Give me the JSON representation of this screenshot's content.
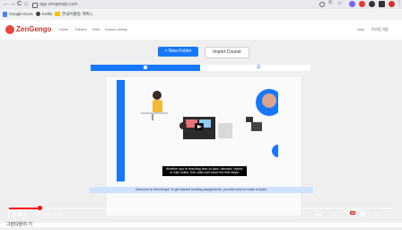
{
  "browser": {
    "nav": {
      "back": "←",
      "forward": "→",
      "reload": "C",
      "home": "⌂"
    },
    "url": "app.zengengo.com",
    "bookmarks": [
      {
        "label": "Google Docs",
        "icon": "docs-icon"
      },
      {
        "label": "Kellio",
        "icon": "kellio-icon"
      },
      {
        "label": "한국어활동 계획 L",
        "icon": "folder-icon"
      }
    ],
    "extension_colors": [
      "#7b61ff",
      "#e53935",
      "#333333",
      "#333333",
      "#d93025"
    ]
  },
  "app": {
    "brand": "ZenGengo",
    "nav": [
      "Home",
      "Folders",
      "Files",
      "Lesson Library"
    ],
    "help": "Help",
    "user": "아리랑 이름"
  },
  "page": {
    "new_folder": "+ New Folder",
    "import_course": "Import Course",
    "view_tabs": [
      "grid-view-icon",
      "list-view-icon"
    ],
    "caption": "Whether you're teaching face-to-face, blended, hybrid, or fully online, this video will cover the first steps.",
    "welcome": "Welcome to ZenGengo! To get started creating assignments, you first need to make a folder.",
    "welcome_link": "make a folder"
  },
  "player": {
    "time": "0:25 / 5:19",
    "progress_fraction": 0.08,
    "hd_badge": "HD",
    "colors": {
      "progress": "#ff0000",
      "accent": "#1677ff"
    }
  },
  "below_video": {
    "title": "그린다원의 기"
  }
}
